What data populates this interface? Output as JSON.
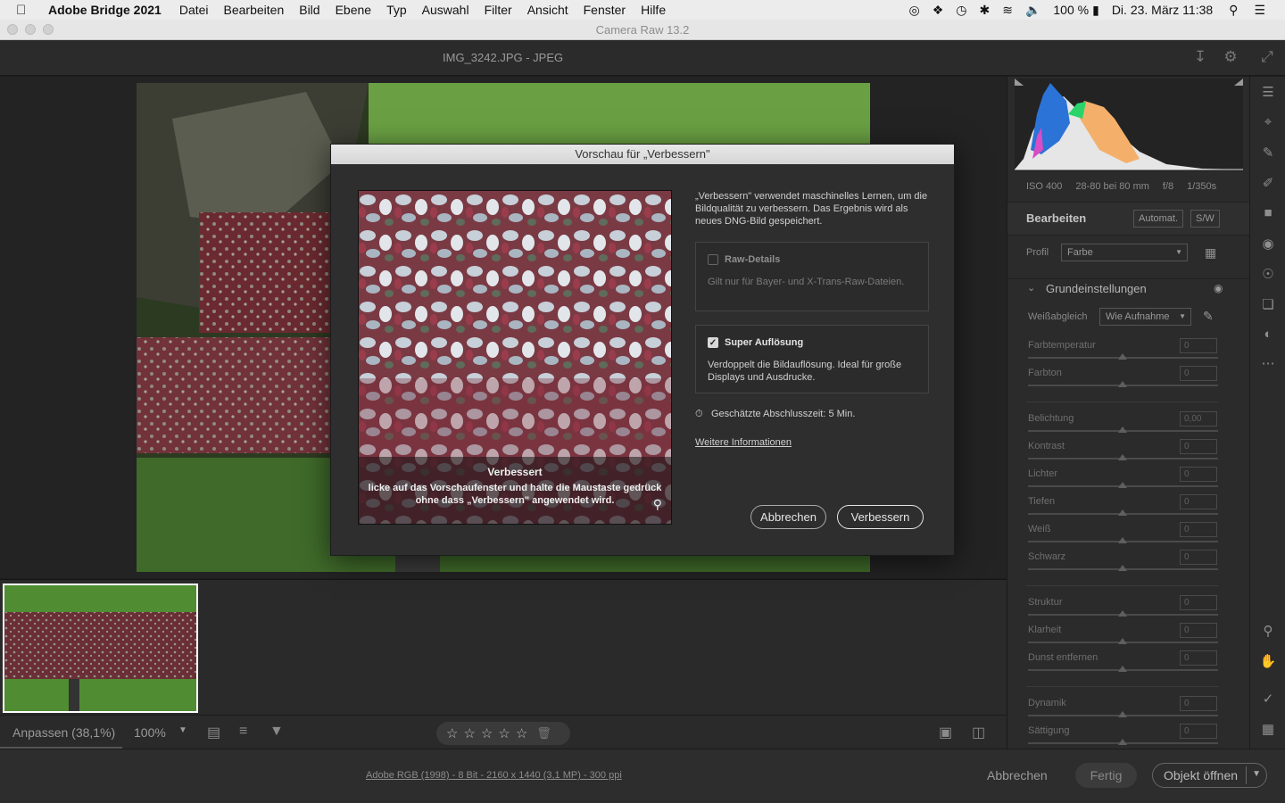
{
  "menubar": {
    "app": "Adobe Bridge 2021",
    "items": [
      "Datei",
      "Bearbeiten",
      "Bild",
      "Ebene",
      "Typ",
      "Auswahl",
      "Filter",
      "Ansicht",
      "Fenster",
      "Hilfe"
    ],
    "battery": "100 %",
    "datetime": "Di. 23. März  11:38"
  },
  "window": {
    "title": "Camera Raw 13.2"
  },
  "header": {
    "filename": "IMG_3242.JPG  -  JPEG"
  },
  "toolbar": {
    "zoom_fit": "Anpassen (38,1%)",
    "zoom_select": "100%"
  },
  "status": {
    "info": "Adobe RGB (1998) - 8 Bit - 2160 x 1440 (3,1 MP) - 300 ppi",
    "cancel": "Abbrechen",
    "done": "Fertig",
    "open": "Objekt öffnen"
  },
  "panel": {
    "camera_info": [
      "ISO 400",
      "28-80 bei 80 mm",
      "f/8",
      "1/350s"
    ],
    "edit_title": "Bearbeiten",
    "auto_btn": "Automat.",
    "bw_btn": "S/W",
    "profile_label": "Profil",
    "profile_value": "Farbe",
    "section_title": "Grundeinstellungen",
    "wb_label": "Weißabgleich",
    "wb_value": "Wie Aufnahme",
    "sliders": {
      "farbtemperatur": {
        "label": "Farbtemperatur",
        "value": "0"
      },
      "farbton": {
        "label": "Farbton",
        "value": "0"
      },
      "belichtung": {
        "label": "Belichtung",
        "value": "0,00"
      },
      "kontrast": {
        "label": "Kontrast",
        "value": "0"
      },
      "lichter": {
        "label": "Lichter",
        "value": "0"
      },
      "tiefen": {
        "label": "Tiefen",
        "value": "0"
      },
      "weiss": {
        "label": "Weiß",
        "value": "0"
      },
      "schwarz": {
        "label": "Schwarz",
        "value": "0"
      },
      "struktur": {
        "label": "Struktur",
        "value": "0"
      },
      "klarheit": {
        "label": "Klarheit",
        "value": "0"
      },
      "dunst": {
        "label": "Dunst entfernen",
        "value": "0"
      },
      "dynamik": {
        "label": "Dynamik",
        "value": "0"
      },
      "saettigung": {
        "label": "Sättigung",
        "value": "0"
      }
    }
  },
  "dialog": {
    "title": "Vorschau für „Verbessern\"",
    "description": "„Verbessern\" verwendet maschinelles Lernen, um die Bildqualität zu verbessern. Das Ergebnis wird als neues DNG-Bild gespeichert.",
    "raw_details": {
      "title": "Raw-Details",
      "desc": "Gilt nur für Bayer- und X-Trans-Raw-Dateien.",
      "checked": false
    },
    "super_resolution": {
      "title": "Super Auflösung",
      "desc": "Verdoppelt die Bildauflösung. Ideal für große Displays und Ausdrucke.",
      "checked": true
    },
    "eta": "Geschätzte Abschlusszeit: 5 Min.",
    "more_info": "Weitere Informationen",
    "preview_caption": "Verbessert",
    "preview_hint_1": "licke auf das Vorschaufenster und halte die Maustaste gedrück",
    "preview_hint_2": "ohne dass „Verbessern\" angewendet wird.",
    "cancel": "Abbrechen",
    "confirm": "Verbessern"
  }
}
